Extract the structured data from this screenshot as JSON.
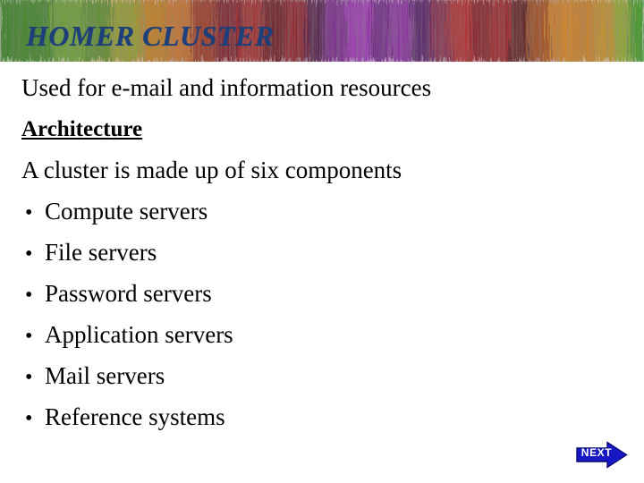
{
  "slide": {
    "title": "HOMER CLUSTER",
    "title_color": "#1d3f7a",
    "background_color": "#ffffff",
    "text_color": "#000000"
  },
  "banner": {
    "name": "colorful-abstract-banner",
    "palette": [
      "#3f8a1e",
      "#6aa82a",
      "#d98a12",
      "#e4671a",
      "#a8161b",
      "#6e0d16",
      "#8c1fa0",
      "#b32ec4",
      "#5a1478",
      "#c94a12",
      "#8fbf25"
    ]
  },
  "body": {
    "intro": "Used for e-mail and information resources",
    "section_heading": "Architecture",
    "lead_in": "A cluster is made up of six components",
    "bullet_glyph": "•",
    "bullets": [
      "Compute servers",
      "File servers",
      "Password servers",
      "Application servers",
      "Mail servers",
      "Reference systems"
    ]
  },
  "nav": {
    "next_label": "NEXT",
    "next_color": "#1717c4"
  }
}
